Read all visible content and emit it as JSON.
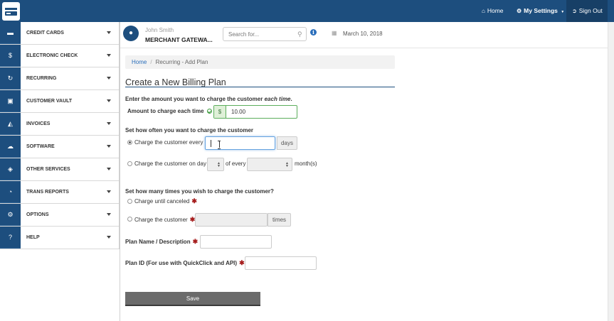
{
  "topbar": {
    "home": "Home",
    "settings": "My Settings",
    "signout": "Sign Out"
  },
  "sidebar": {
    "items": [
      {
        "label": "CREDIT CARDS",
        "icon": "credit-card-icon"
      },
      {
        "label": "ELECTRONIC CHECK",
        "icon": "dollar-icon"
      },
      {
        "label": "RECURRING",
        "icon": "refresh-icon"
      },
      {
        "label": "CUSTOMER VAULT",
        "icon": "lock-icon"
      },
      {
        "label": "INVOICES",
        "icon": "inbox-icon"
      },
      {
        "label": "SOFTWARE",
        "icon": "cloud-icon"
      },
      {
        "label": "OTHER SERVICES",
        "icon": "tag-icon"
      },
      {
        "label": "TRANS REPORTS",
        "icon": "pie-chart-icon"
      },
      {
        "label": "OPTIONS",
        "icon": "cogs-icon"
      },
      {
        "label": "HELP",
        "icon": "question-icon"
      }
    ]
  },
  "header": {
    "user_name": "John Smith",
    "gateway": "MERCHANT GATEWA...",
    "search_placeholder": "Search for...",
    "date": "March 10, 2018"
  },
  "breadcrumb": {
    "home": "Home",
    "sep": "/",
    "current": "Recurring - Add Plan"
  },
  "form": {
    "title": "Create a New Billing Plan",
    "amount_heading_pre": "Enter the amount you want to charge the customer ",
    "amount_heading_em": "each time",
    "amount_heading_post": ".",
    "amount_label": "Amount to charge each time",
    "currency_symbol": "$",
    "amount_value": "10.00",
    "frequency_heading": "Set how often you want to charge the customer",
    "every_label": "Charge the customer every",
    "every_value": "",
    "days_addon": "days",
    "on_day_label": "Charge the customer on day",
    "of_every_label": "of every",
    "months_label": "month(s)",
    "times_heading": "Set how many times you wish to charge the customer?",
    "until_canceled_label": "Charge until canceled",
    "charge_times_label": "Charge the customer",
    "times_addon": "times",
    "plan_name_label": "Plan Name / Description",
    "plan_id_label": "Plan ID (For use with QuickClick and API)",
    "required_mark": "✱",
    "save_label": "Save"
  }
}
